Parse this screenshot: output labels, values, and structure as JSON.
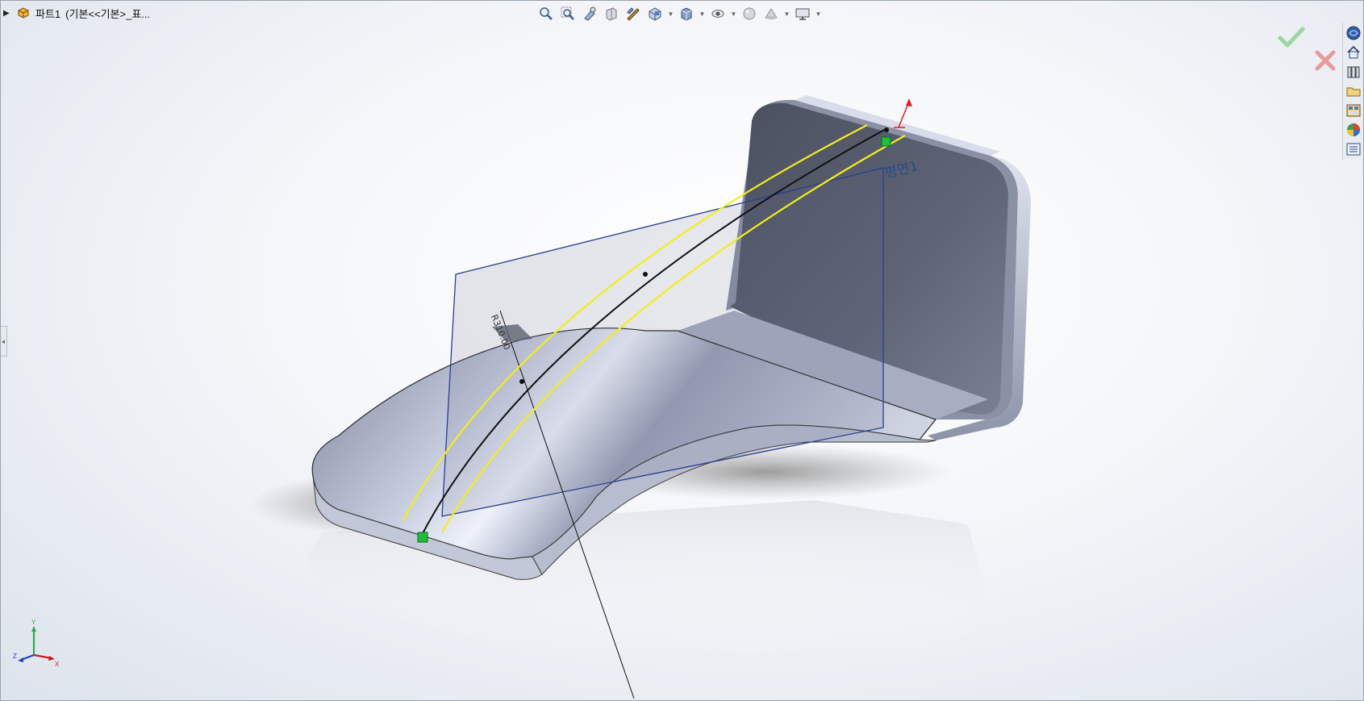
{
  "tree": {
    "expand_icon": "triangle-right-icon",
    "part_icon": "part-icon",
    "part_name": "파트1",
    "config_label": "(기본<<기본>_표..."
  },
  "hud_toolbar": {
    "buttons": [
      "zoom-to-fit-icon",
      "zoom-to-area-icon",
      "previous-view-icon",
      "section-view-icon",
      "dynamic-annotation-icon",
      "view-orientation-icon",
      "display-style-icon",
      "hide-show-items-icon",
      "edit-appearance-icon",
      "apply-scene-icon",
      "view-settings-icon"
    ]
  },
  "confirm": {
    "ok_icon": "checkmark-icon",
    "cancel_icon": "cancel-x-icon"
  },
  "task_pane": {
    "buttons": [
      "solidworks-resources-icon",
      "home-icon",
      "design-library-icon",
      "file-explorer-icon",
      "view-palette-icon",
      "appearances-icon",
      "custom-properties-icon"
    ]
  },
  "model": {
    "plane_label": "평면1",
    "dimension_label": "R310.00"
  },
  "triad": {
    "x_label": "X",
    "y_label": "Y",
    "z_label": "Z"
  },
  "colors": {
    "guide_curve": "#f2ee1a",
    "sketch_line": "#111111",
    "plane_edge": "#2a3f8f",
    "handle_green": "#1fbf3a",
    "axis_red": "#e11d1d"
  }
}
